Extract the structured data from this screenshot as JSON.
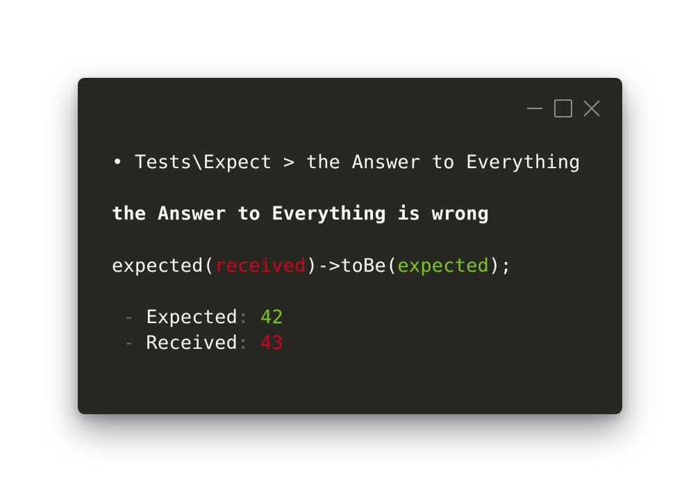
{
  "window": {
    "controls": [
      {
        "name": "minimize-icon"
      },
      {
        "name": "maximize-icon"
      },
      {
        "name": "close-icon"
      }
    ]
  },
  "output": {
    "test_bullet": "•",
    "test_name": "Tests\\Expect > the Answer to Everything",
    "message": "the Answer to Everything is wrong",
    "code": {
      "prefix": "expected(",
      "received": "received",
      "middle": ")->toBe(",
      "expected": "expected",
      "suffix": ");"
    },
    "diff": {
      "expected_dash": "-",
      "expected_label": "Expected",
      "expected_colon": ":",
      "expected_value": "42",
      "received_dash": "-",
      "received_label": "Received",
      "received_colon": ":",
      "received_value": "43"
    }
  },
  "colors": {
    "background": "#282823",
    "text": "#f8f8f2",
    "expected": "#7ec522",
    "received": "#d0021b",
    "dim": "#6a6a63"
  }
}
